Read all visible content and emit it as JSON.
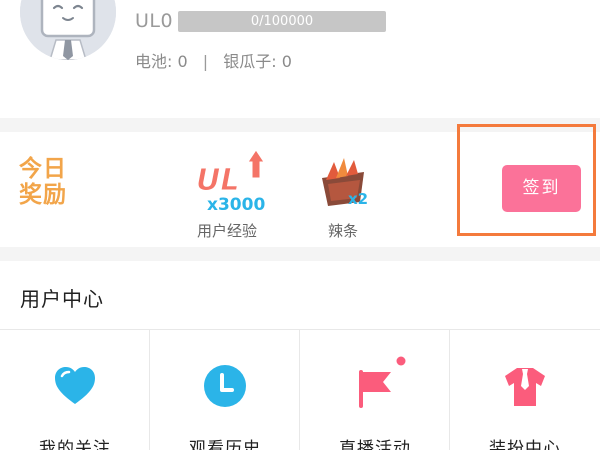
{
  "profile": {
    "level": "UL0",
    "exp_text": "0/100000",
    "exp_progress": 0,
    "battery_label": "电池",
    "battery_sep": ":",
    "battery_value": "0",
    "divider": "|",
    "silver_label": "银瓜子",
    "silver_sep": ":",
    "silver_value": "0"
  },
  "reward": {
    "title": "今日奖励",
    "items": [
      {
        "label": "用户经验",
        "badge": "UL",
        "multiplier": "x3000",
        "icon": "experience-badge"
      },
      {
        "label": "辣条",
        "multiplier": "x2",
        "icon": "spicy-strip"
      }
    ],
    "signin_label": "签到"
  },
  "user_center": {
    "title": "用户中心",
    "items": [
      {
        "label": "我的关注",
        "icon": "heart-icon",
        "color": "#2bb4e8"
      },
      {
        "label": "观看历史",
        "icon": "clock-icon",
        "color": "#2bb4e8"
      },
      {
        "label": "直播活动",
        "icon": "flag-icon",
        "color": "#fb5c7c"
      },
      {
        "label": "装扮中心",
        "icon": "shirt-icon",
        "color": "#fb5c7c"
      }
    ]
  },
  "colors": {
    "accent": "#fb7299",
    "reward_title": "#f2a54a",
    "highlight": "#f47a3c",
    "blue_icon": "#2bb4e8"
  }
}
